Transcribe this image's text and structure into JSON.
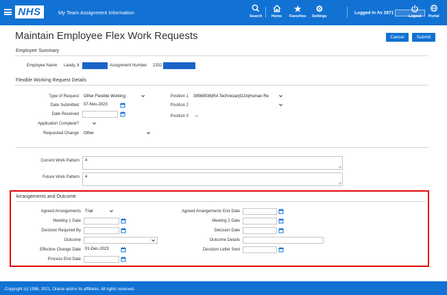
{
  "header": {
    "logo": "NHS",
    "title": "My Team Assignment Information",
    "nav": [
      {
        "label": "Search",
        "icon": "search-icon",
        "glyph": "⌕"
      },
      {
        "label": "Home",
        "icon": "home-icon",
        "glyph": "⌂"
      },
      {
        "label": "Favorites",
        "icon": "star-icon",
        "glyph": "★"
      },
      {
        "label": "Settings",
        "icon": "gear-icon",
        "glyph": "⚙"
      }
    ],
    "logged_in_as": "Logged In As 2871",
    "logout": "Logout",
    "portal": "Portal"
  },
  "page": {
    "title": "Maintain Employee Flex Work Requests",
    "cancel_label": "Cancel",
    "submit_label": "Submit"
  },
  "summary": {
    "section_title": "Employee Summary",
    "employee_name_label": "Employee Name",
    "employee_name_value": "Landy, 8",
    "assignment_number_label": "Assignment Number",
    "assignment_number_value": "2332"
  },
  "request": {
    "section_title": "Flexible Working Request Details",
    "type_label": "Type of Request",
    "type_value": "Other Flexible Working",
    "date_submitted_label": "Date Submitted",
    "date_submitted_value": "07-Nov-2023",
    "date_received_label": "Date Received",
    "date_received_value": "",
    "app_complete_label": "Application Complete?",
    "app_complete_value": "",
    "requested_change_label": "Requested Change",
    "requested_change_value": "Other",
    "position1_label": "Position 1",
    "position1_value": "39568036|RA Technician|G2A|Human Re",
    "position2_label": "Position 2",
    "position2_value": "",
    "position3_label": "Position 3",
    "position3_value": "",
    "current_pattern_label": "Current Work Pattern",
    "current_pattern_value": "a",
    "future_pattern_label": "Future Work Pattern",
    "future_pattern_value": "a"
  },
  "outcome": {
    "section_title": "Arrangements and Outcome",
    "agreed_label": "Agreed Arrangements",
    "agreed_value": "Trial",
    "meeting1_label": "Meeting 1 Date",
    "meeting1_value": "",
    "decision_required_label": "Decision Required By",
    "decision_required_value": "",
    "outcome_label": "Outcome",
    "outcome_value": "",
    "effective_label": "Effective Change Date",
    "effective_value": "01-Dec-2023",
    "process_end_label": "Process End Date",
    "process_end_value": "",
    "agreed_end_label": "Agreed Arrangements End Date",
    "agreed_end_value": "",
    "meeting2_label": "Meeting 2 Date",
    "meeting2_value": "",
    "decision_date_label": "Decision Date",
    "decision_date_value": "",
    "outcome_details_label": "Outcome Details",
    "outcome_details_value": "",
    "decision_letter_label": "Decision Letter Sent",
    "decision_letter_value": ""
  },
  "footer": {
    "copyright": "Copyright (c) 1998, 2021, Oracle and/or its affiliates. All rights reserved."
  },
  "colors": {
    "brand_blue": "#1272d3",
    "highlight_red": "#e10a0a",
    "redaction_blue": "#1c63c9"
  }
}
